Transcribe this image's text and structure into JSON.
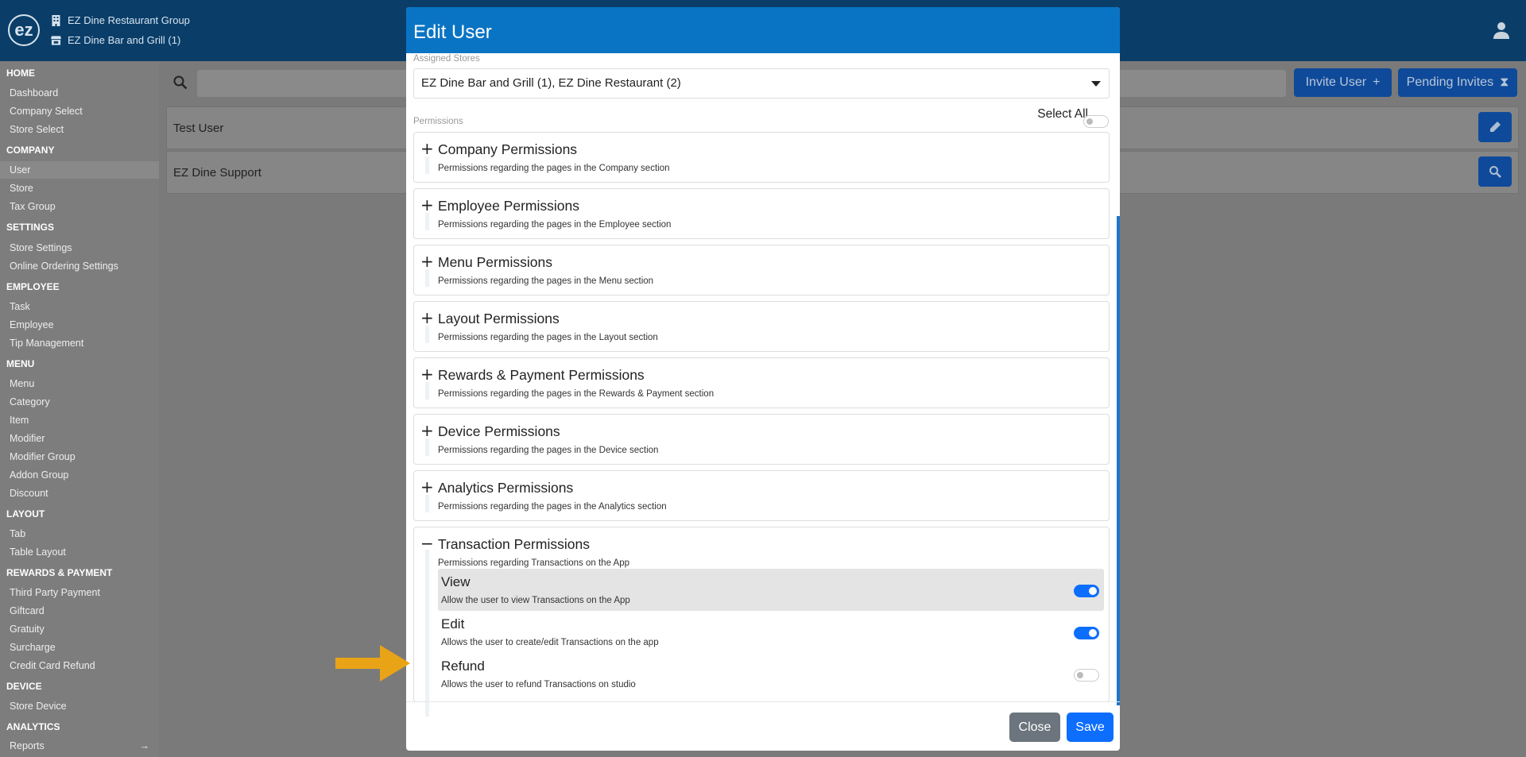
{
  "topbar": {
    "logo_text": "ez",
    "company": "EZ Dine Restaurant Group",
    "store": "EZ Dine Bar and Grill (1)",
    "user_icon": "user-icon"
  },
  "sidebar": {
    "sections": [
      {
        "title": "HOME",
        "items": [
          "Dashboard",
          "Company Select",
          "Store Select"
        ]
      },
      {
        "title": "COMPANY",
        "items": [
          "User",
          "Store",
          "Tax Group"
        ]
      },
      {
        "title": "SETTINGS",
        "items": [
          "Store Settings",
          "Online Ordering Settings"
        ]
      },
      {
        "title": "EMPLOYEE",
        "items": [
          "Task",
          "Employee",
          "Tip Management"
        ]
      },
      {
        "title": "MENU",
        "items": [
          "Menu",
          "Category",
          "Item",
          "Modifier",
          "Modifier Group",
          "Addon Group",
          "Discount"
        ]
      },
      {
        "title": "LAYOUT",
        "items": [
          "Tab",
          "Table Layout"
        ]
      },
      {
        "title": "REWARDS & PAYMENT",
        "items": [
          "Third Party Payment",
          "Giftcard",
          "Gratuity",
          "Surcharge",
          "Credit Card Refund"
        ]
      },
      {
        "title": "DEVICE",
        "items": [
          "Store Device"
        ]
      },
      {
        "title": "ANALYTICS",
        "items": [
          "Reports"
        ]
      }
    ],
    "active_item": "User",
    "reports_arrow": "→"
  },
  "background": {
    "invite_user_label": "Invite User",
    "invite_user_icon": "+",
    "pending_invites_label": "Pending Invites",
    "pending_invites_icon": "⧗",
    "rows": [
      {
        "name": "Test User",
        "action_icon": "pencil-icon"
      },
      {
        "name": "EZ Dine Support",
        "action_icon": "search-icon"
      }
    ]
  },
  "modal": {
    "title": "Edit User",
    "assigned_stores_label": "Assigned Stores",
    "assigned_stores_value": "EZ Dine Bar and Grill (1), EZ Dine Restaurant (2)",
    "permissions_label": "Permissions",
    "select_all_label": "Select All",
    "select_all_on": false,
    "collapsed_icon": "+",
    "expanded_icon": "−",
    "permission_groups": [
      {
        "title": "Company Permissions",
        "desc": "Permissions regarding the pages in the Company section"
      },
      {
        "title": "Employee Permissions",
        "desc": "Permissions regarding the pages in the Employee section"
      },
      {
        "title": "Menu Permissions",
        "desc": "Permissions regarding the pages in the Menu section"
      },
      {
        "title": "Layout Permissions",
        "desc": "Permissions regarding the pages in the Layout section"
      },
      {
        "title": "Rewards & Payment Permissions",
        "desc": "Permissions regarding the pages in the Rewards & Payment section"
      },
      {
        "title": "Device Permissions",
        "desc": "Permissions regarding the pages in the Device section"
      },
      {
        "title": "Analytics Permissions",
        "desc": "Permissions regarding the pages in the Analytics section"
      }
    ],
    "transaction": {
      "title": "Transaction Permissions",
      "desc": "Permissions regarding Transactions on the App",
      "items": [
        {
          "title": "View",
          "desc": "Allow the user to view Transactions on the App",
          "on": true
        },
        {
          "title": "Edit",
          "desc": "Allows the user to create/edit Transactions on the app",
          "on": true
        },
        {
          "title": "Refund",
          "desc": "Allows the user to refund Transactions on studio",
          "on": false
        }
      ]
    },
    "close_label": "Close",
    "save_label": "Save"
  },
  "colors": {
    "header": "#0a74c4",
    "toggle_on": "#0d6efd",
    "annotation_arrow": "#e8a317"
  }
}
